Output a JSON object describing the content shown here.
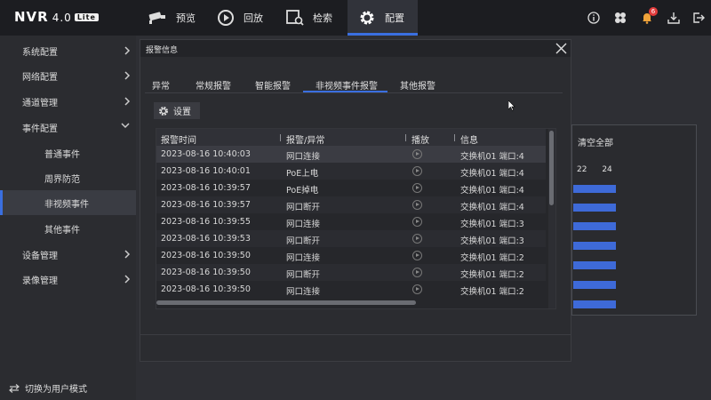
{
  "app": {
    "brand": "NVR",
    "version": "4.0",
    "edition": "Lite"
  },
  "nav": [
    {
      "label": "预览",
      "icon": "camera-icon"
    },
    {
      "label": "回放",
      "icon": "playback-icon"
    },
    {
      "label": "检索",
      "icon": "search-folder-icon"
    },
    {
      "label": "配置",
      "icon": "gear-icon",
      "active": true
    }
  ],
  "top_icons": {
    "notification_count": "6"
  },
  "sidebar": {
    "items": [
      {
        "label": "系统配置"
      },
      {
        "label": "网络配置"
      },
      {
        "label": "通道管理"
      },
      {
        "label": "事件配置"
      },
      {
        "label": "普通事件"
      },
      {
        "label": "周界防范"
      },
      {
        "label": "非视频事件"
      },
      {
        "label": "其他事件"
      },
      {
        "label": "设备管理"
      },
      {
        "label": "录像管理"
      }
    ],
    "switch_mode": "切换为用户模式"
  },
  "background": {
    "clear_all": "清空全部",
    "num_a": "22",
    "num_b": "24"
  },
  "dialog": {
    "title": "报警信息",
    "tabs": [
      "异常",
      "常规报警",
      "智能报警",
      "非视频事件报警",
      "其他报警"
    ],
    "active_tab": 3,
    "settings_label": "设置",
    "columns": [
      "报警时间",
      "报警/异常",
      "播放",
      "信息"
    ],
    "rows": [
      {
        "time": "2023-08-16 10:40:03",
        "type": "网口连接",
        "info": "交换机01 端口:4"
      },
      {
        "time": "2023-08-16 10:40:01",
        "type": "PoE上电",
        "info": "交换机01 端口:4"
      },
      {
        "time": "2023-08-16 10:39:57",
        "type": "PoE掉电",
        "info": "交换机01 端口:4"
      },
      {
        "time": "2023-08-16 10:39:57",
        "type": "网口断开",
        "info": "交换机01 端口:4"
      },
      {
        "time": "2023-08-16 10:39:55",
        "type": "网口连接",
        "info": "交换机01 端口:3"
      },
      {
        "time": "2023-08-16 10:39:53",
        "type": "网口断开",
        "info": "交换机01 端口:3"
      },
      {
        "time": "2023-08-16 10:39:50",
        "type": "网口连接",
        "info": "交换机01 端口:2"
      },
      {
        "time": "2023-08-16 10:39:50",
        "type": "网口断开",
        "info": "交换机01 端口:2"
      },
      {
        "time": "2023-08-16 10:39:50",
        "type": "网口连接",
        "info": "交换机01 端口:2"
      }
    ]
  },
  "colors": {
    "accent": "#3a6fe0",
    "badge": "#e13b3b"
  }
}
